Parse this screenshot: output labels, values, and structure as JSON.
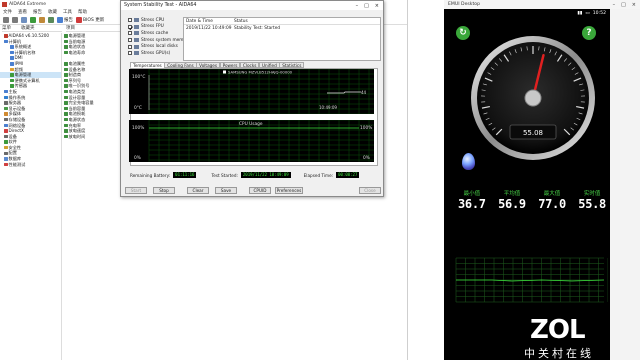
{
  "aida": {
    "title": "AIDA64 Extreme",
    "menu": [
      "文件",
      "查看",
      "报告",
      "收藏",
      "工具",
      "帮助"
    ],
    "toolbar": {
      "report_label": "报告",
      "bios_label": "BIOS 更新"
    },
    "col_menu": "菜单",
    "col_favorites": "收藏夹",
    "col_items": "项目",
    "tree": [
      "AIDA64 v6.10.5200",
      "计算机",
      "系统概述",
      "计算机名称",
      "DMI",
      "IPMI",
      "超频",
      "电源管理",
      "便携式计算机",
      "传感器",
      "主板",
      "操作系统",
      "服务器",
      "显示设备",
      "多媒体",
      "存储设备",
      "网络设备",
      "DirectX",
      "设备",
      "软件",
      "安全性",
      "配置",
      "数据库",
      "性能测试"
    ],
    "items": [
      "电源管理",
      "当前电源",
      "电池状态",
      "电池寿命",
      "",
      "电池属性",
      "设备名称",
      "制造商",
      "序列号",
      "唯一识别号",
      "电池类型",
      "设计容量",
      "完全充电容量",
      "当前容量",
      "电池损耗",
      "电源状态",
      "充电率",
      "放电速度",
      "放电时间"
    ]
  },
  "dialog": {
    "title": "System Stability Test - AIDA64",
    "checks": [
      {
        "label": "Stress CPU",
        "checked": false
      },
      {
        "label": "Stress FPU",
        "checked": true
      },
      {
        "label": "Stress cache",
        "checked": false
      },
      {
        "label": "Stress system memory",
        "checked": false
      },
      {
        "label": "Stress local disks",
        "checked": false
      },
      {
        "label": "Stress GPU(s)",
        "checked": false
      }
    ],
    "status_headers": {
      "date": "Date & Time",
      "status": "Status"
    },
    "status_row": {
      "date": "2019/11/22 10:49:09",
      "status": "Stability Test: Started"
    },
    "tabs": [
      "Temperatures",
      "Cooling Fans",
      "Voltages",
      "Powers",
      "Clocks",
      "Unified",
      "Statistics"
    ],
    "temp_graph": {
      "y_max_label": "100°C",
      "y_min_label": "0°C",
      "legend": "SAMSUNG MZVLB512HAJQ-00000",
      "value_label": "44",
      "time_label": "10:49:09"
    },
    "cpu_graph": {
      "title": "CPU Usage",
      "y_max_label": "100%",
      "y_min_label": "0%",
      "right_top_label": "100%",
      "right_bottom_label": "0%"
    },
    "remaining_battery_label": "Remaining Battery:",
    "remaining_battery_value": "01:11:16",
    "test_started_label": "Test Started:",
    "test_started_value": "2019/11/22 10:49:09",
    "elapsed_label": "Elapsed Time:",
    "elapsed_value": "00:00:27",
    "buttons": [
      "Start",
      "Stop",
      "Clear",
      "Save",
      "CPUID",
      "Preferences",
      "Close"
    ]
  },
  "emui": {
    "title": "EMUI Desktop",
    "status_time": "10:52",
    "gauge_value": "55.08",
    "gauge_value_display": "55.08",
    "stats": [
      {
        "label": "最小值",
        "value": "36.7"
      },
      {
        "label": "平均值",
        "value": "56.9"
      },
      {
        "label": "最大值",
        "value": "77.0"
      },
      {
        "label": "实时值",
        "value": "55.8"
      }
    ],
    "logo": "ZOL",
    "logo_cn": "中关村在线",
    "accent": "#47d147"
  }
}
